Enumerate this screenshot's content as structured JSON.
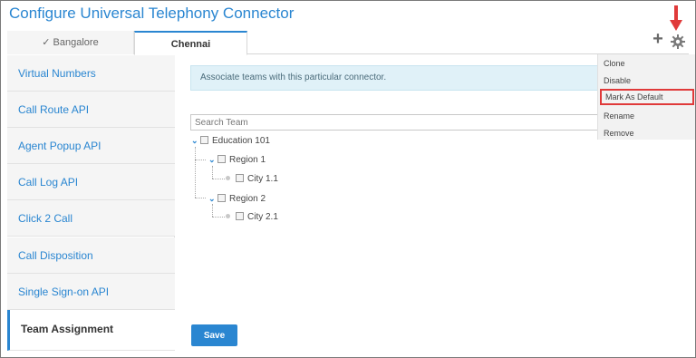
{
  "page": {
    "title": "Configure Universal Telephony Connector"
  },
  "tabs": [
    {
      "label": "✓ Bangalore"
    },
    {
      "label": "Chennai"
    }
  ],
  "toolbar": {
    "add_icon": "plus-icon",
    "settings_icon": "gear-icon",
    "arrow_color": "#e03a3a"
  },
  "sidebar": {
    "items": [
      {
        "label": "Virtual Numbers"
      },
      {
        "label": "Call Route API"
      },
      {
        "label": "Agent Popup API"
      },
      {
        "label": "Call Log API"
      },
      {
        "label": "Click 2 Call"
      },
      {
        "label": "Call Disposition"
      },
      {
        "label": "Single Sign-on API"
      },
      {
        "label": "Team Assignment"
      }
    ]
  },
  "info": {
    "text": "Associate teams with this particular connector."
  },
  "search": {
    "placeholder": "Search Team"
  },
  "tree": {
    "root": "Education 101",
    "region1": "Region 1",
    "city11": "City 1.1",
    "region2": "Region 2",
    "city21": "City 2.1"
  },
  "menu": {
    "items": [
      {
        "label": "Clone"
      },
      {
        "label": "Disable"
      },
      {
        "label": "Mark As Default"
      },
      {
        "label": "Rename"
      },
      {
        "label": "Remove"
      }
    ]
  },
  "save_label": "Save",
  "colors": {
    "accent": "#2a86d1",
    "highlight": "#e03a3a"
  }
}
